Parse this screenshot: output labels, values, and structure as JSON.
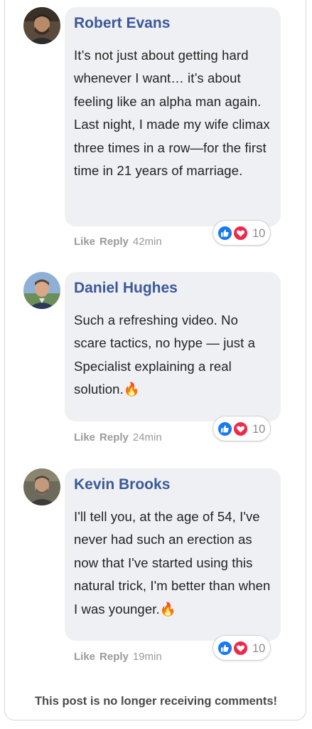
{
  "comments": [
    {
      "author": "Robert Evans",
      "text": "It’s not just about getting hard whenever I want… it’s about feeling like an alpha man again. Last night, I made my wife climax three times in a row—for the first time in 21 years of marriage.",
      "like_label": "Like",
      "reply_label": "Reply",
      "separator": "",
      "time": "42min",
      "reaction_count": "10"
    },
    {
      "author": "Daniel Hughes",
      "text": "Such a refreshing video. No scare tactics, no hype — just a Specialist explaining a real solution.🔥",
      "like_label": "Like",
      "reply_label": "Reply",
      "separator": "",
      "time": "24min",
      "reaction_count": "10"
    },
    {
      "author": "Kevin Brooks",
      "text": "I'll tell you, at the age of 54, I've never had such an erection as now that I've started using this natural trick, I'm better than when I was younger.🔥",
      "like_label": "Like",
      "reply_label": "Reply",
      "separator": "",
      "time": "19min",
      "reaction_count": "10"
    }
  ],
  "reaction_icons": [
    "like-icon",
    "heart-icon"
  ],
  "colors": {
    "author_name": "#3b5998",
    "bubble_bg": "#eff0f4",
    "like_blue": "#1877f2",
    "heart_red": "#f02849"
  },
  "footer": {
    "closed_notice": "This post is no longer receiving comments!"
  }
}
